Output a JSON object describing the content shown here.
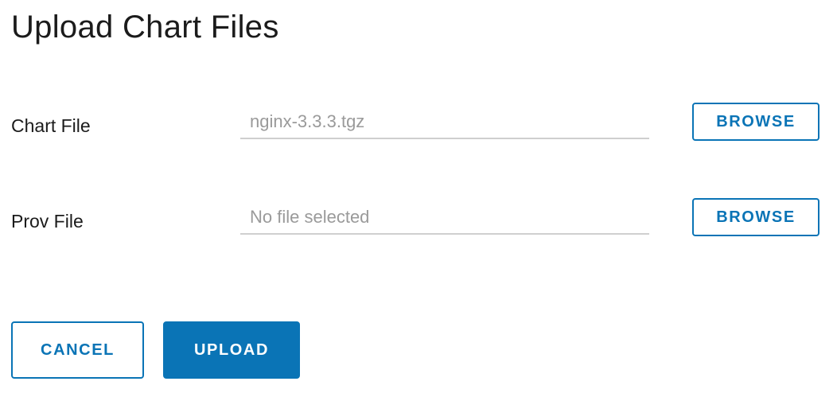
{
  "dialog": {
    "title": "Upload Chart Files"
  },
  "chart_file": {
    "label": "Chart File",
    "value": "nginx-3.3.3.tgz",
    "browse_label": "BROWSE"
  },
  "prov_file": {
    "label": "Prov File",
    "value": "No file selected",
    "browse_label": "BROWSE"
  },
  "actions": {
    "cancel_label": "CANCEL",
    "upload_label": "UPLOAD"
  },
  "colors": {
    "accent": "#0a74b6",
    "placeholder_text": "#9a9a9a",
    "underline": "#cfcfcf"
  }
}
